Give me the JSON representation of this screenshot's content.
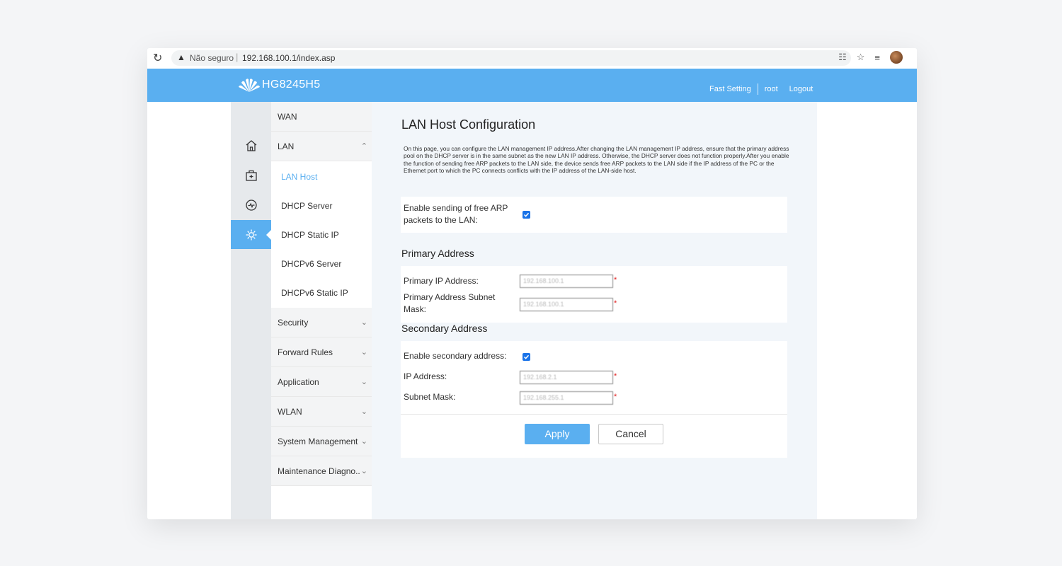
{
  "browser": {
    "warning_icon": "warning-triangle-icon",
    "security_label": "Não seguro",
    "separator": "|",
    "url": "192.168.100.1/index.asp"
  },
  "header": {
    "brand": "HG8245H5",
    "fast_setting": "Fast Setting",
    "user": "root",
    "logout": "Logout",
    "brand_color": "#5aaff0"
  },
  "rail": {
    "icons": [
      "home-icon",
      "medical-box-icon",
      "diagnostics-icon",
      "settings-gear-icon"
    ],
    "active": "settings-gear-icon"
  },
  "menu": {
    "wan": "WAN",
    "lan": "LAN",
    "lan_children": [
      "LAN Host",
      "DHCP Server",
      "DHCP Static IP",
      "DHCPv6 Server",
      "DHCPv6 Static IP"
    ],
    "security": "Security",
    "forward_rules": "Forward Rules",
    "application": "Application",
    "wlan": "WLAN",
    "system_management": "System Management",
    "maintenance": "Maintenance Diagno.."
  },
  "page": {
    "title": "LAN Host Configuration",
    "description": "On this page, you can configure the LAN management IP address.After changing the LAN management IP address, ensure that the primary address pool on the DHCP server is in the same subnet as the new LAN IP address. Otherwise, the DHCP server does not function properly.After you enable the function of sending free ARP packets to the LAN side, the device sends free ARP packets to the LAN side if the IP address of the PC or the Ethernet port to which the PC connects conflicts with the IP address of the LAN-side host.",
    "arp_label": "Enable sending of free ARP packets to the LAN:",
    "arp_checked": true,
    "primary_section": "Primary Address",
    "primary_ip_label": "Primary IP Address:",
    "primary_ip_value": "192.168.100.1",
    "primary_mask_label": "Primary Address Subnet Mask:",
    "primary_mask_value": "192.168.100.1",
    "secondary_section": "Secondary Address",
    "secondary_enable_label": "Enable secondary address:",
    "secondary_checked": true,
    "ip_label": "IP Address:",
    "ip_value": "192.168.2.1",
    "mask_label": "Subnet Mask:",
    "mask_value": "192.168.255.1",
    "required_mark": "*",
    "apply": "Apply",
    "cancel": "Cancel"
  }
}
